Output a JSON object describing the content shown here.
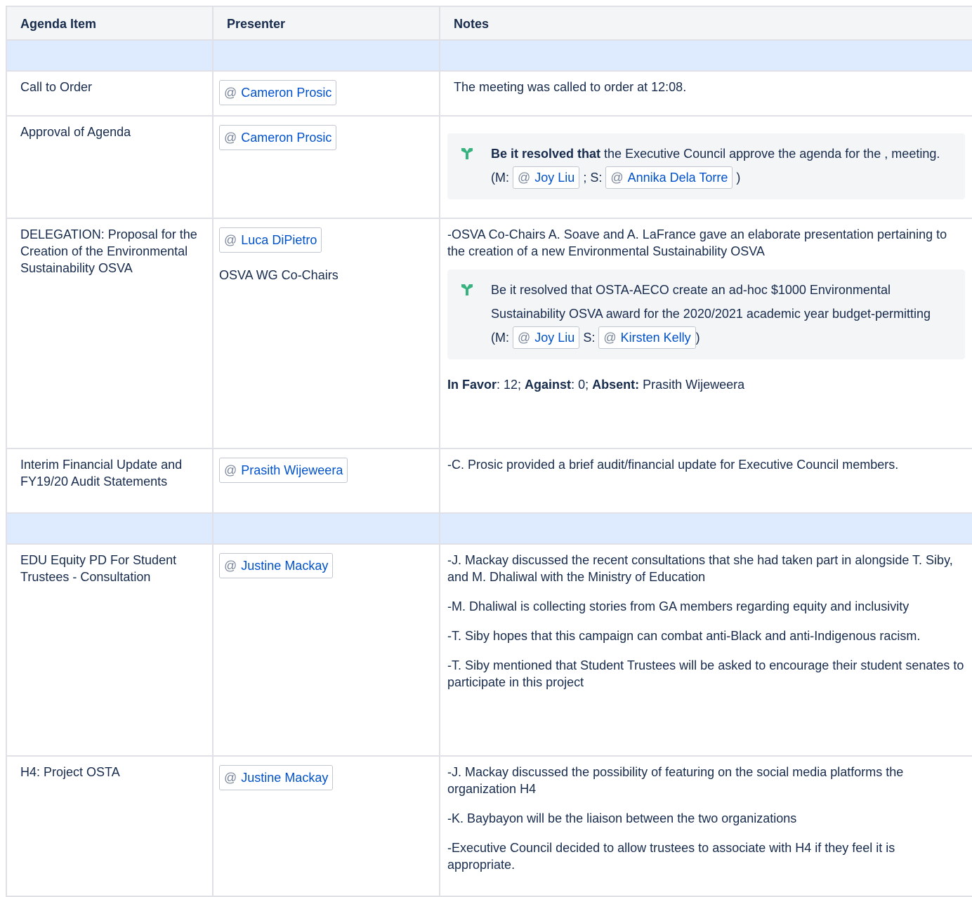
{
  "headers": {
    "agenda": "Agenda Item",
    "presenter": "Presenter",
    "notes": "Notes"
  },
  "rows": {
    "r1": {
      "item": "Call to Order",
      "presenter": "Cameron Prosic",
      "note": "The meeting was called to order at 12:08."
    },
    "r2": {
      "item": "Approval of Agenda",
      "presenter": "Cameron Prosic",
      "motion": {
        "bold": "Be it resolved that",
        "text": " the Executive Council approve the agenda for the , meeting. (M: ",
        "mover": "Joy Liu",
        "sep": " ; S: ",
        "seconder": "Annika Dela Torre",
        "end": " )"
      }
    },
    "r3": {
      "item": "DELEGATION: Proposal for the Creation of the Environmental Sustainability OSVA",
      "presenter": "Luca DiPietro",
      "presenter_note": "OSVA WG Co-Chairs",
      "note": "-OSVA Co-Chairs A. Soave and A. LaFrance gave an elaborate presentation pertaining to the creation of a new Environmental Sustainability OSVA",
      "motion": {
        "text": "Be it resolved that OSTA-AECO create an ad-hoc $1000 Environmental Sustainability OSVA award for the 2020/2021 academic year budget-permitting (M: ",
        "mover": "Joy Liu",
        "sep": " S: ",
        "seconder": "Kirsten Kelly",
        "end": ")"
      },
      "vote": {
        "favor_label": "In Favor",
        "favor": ": 12; ",
        "against_label": "Against",
        "against": ": 0; ",
        "absent_label": "Absent:",
        "absent": " Prasith Wijeweera"
      }
    },
    "r4": {
      "item": "Interim Financial Update and FY19/20 Audit Statements",
      "presenter": "Prasith Wijeweera",
      "note": "-C. Prosic provided a brief audit/financial update for Executive Council members."
    },
    "r5": {
      "item": "EDU Equity PD For Student Trustees - Consultation",
      "presenter": "Justine Mackay",
      "notes": [
        "-J. Mackay discussed the recent consultations that she had taken part in alongside T. Siby, and M. Dhaliwal with the Ministry of Education",
        "-M. Dhaliwal is collecting stories from GA members regarding equity and inclusivity",
        "-T. Siby hopes that this campaign can combat anti-Black and anti-Indigenous racism.",
        "-T. Siby mentioned that Student Trustees will be asked to encourage their student senates to participate in this project"
      ]
    },
    "r6": {
      "item": "H4: Project OSTA",
      "presenter": "Justine Mackay",
      "notes": [
        "-J. Mackay discussed the possibility of featuring on the social media platforms the organization H4",
        "-K. Baybayon will be the liaison between the two organizations",
        "-Executive Council decided to allow trustees to associate with H4 if they feel it is appropriate."
      ]
    }
  },
  "mention_prefix": "@",
  "colors": {
    "highlight_row": "#deebff",
    "panel": "#f4f5f7",
    "mention": "#0052cc",
    "icon": "#36b37e"
  }
}
